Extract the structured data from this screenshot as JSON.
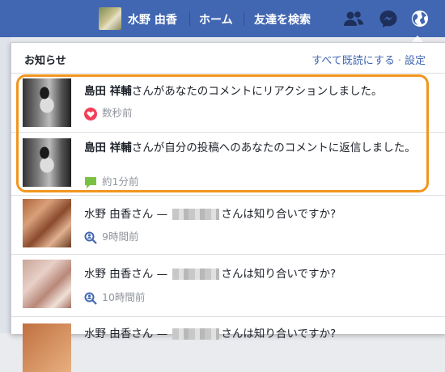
{
  "topbar": {
    "user_name": "水野 由香",
    "home": "ホーム",
    "find_friends": "友達を検索",
    "icons": [
      "friend-requests-icon",
      "messenger-icon",
      "globe-notifications-icon"
    ],
    "color": "#4267b2"
  },
  "panel": {
    "title": "お知らせ",
    "mark_all_read": "すべて既読にする",
    "settings": "設定"
  },
  "notifications": [
    {
      "name": "島田 祥輔",
      "text": "さんがあなたのコメントにリアクションしました。",
      "time": "数秒前",
      "icon": "heart-reaction-icon"
    },
    {
      "name": "島田 祥輔",
      "text": "さんが自分の投稿へのあなたのコメントに返信しました。",
      "time": "約1分前",
      "icon": "comment-icon"
    },
    {
      "name": "水野 由香さん",
      "dash": "—",
      "text": "さんは知り合いですか?",
      "time": "9時間前",
      "icon": "people-search-icon"
    },
    {
      "name": "水野 由香さん",
      "dash": "—",
      "text": "さんは知り合いですか?",
      "time": "10時間前",
      "icon": "people-search-icon"
    },
    {
      "name": "水野 由香さん",
      "dash": "—",
      "text": "さんは知り合いですか?"
    }
  ]
}
